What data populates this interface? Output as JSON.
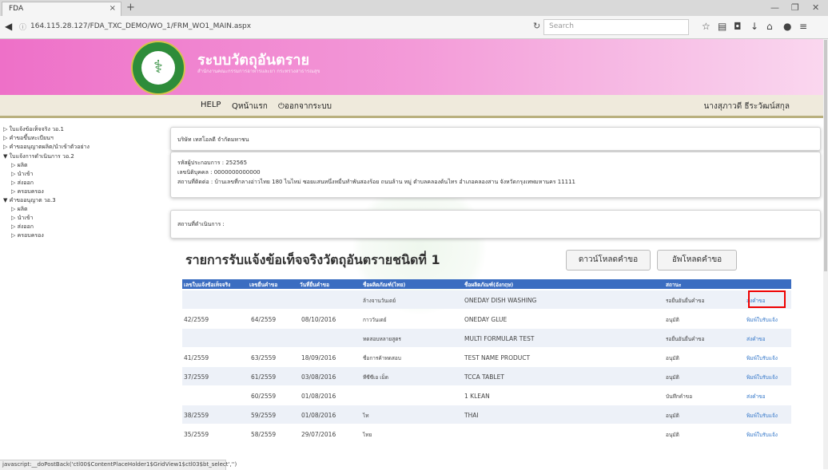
{
  "browser": {
    "tab_title": "FDA",
    "tab_close": "×",
    "new_tab": "+",
    "url": "164.115.28.127/FDA_TXC_DEMO/WO_1/FRM_WO1_MAIN.aspx",
    "search_placeholder": "Search",
    "status_text": "javascript:__doPostBack('ctl00$ContentPlaceHolder1$GridView1$ctl03$bt_select','')"
  },
  "header": {
    "site_title": "ระบบวัตถุอันตราย",
    "site_subtitle": "สำนักงานคณะกรรมการอาหารและยา กระทรวงสาธารณสุข"
  },
  "nav": {
    "help": "HELP",
    "home": "หน้าแรก",
    "logout": "ออกจากระบบ",
    "user_name": "นางสุภาวดี ธีระวัฒน์สกุล"
  },
  "sidebar": [
    {
      "label": "▷ ใบแจ้งข้อเท็จจริง วอ.1",
      "level": 0
    },
    {
      "label": "▷ คำขอขึ้นทะเบียนฯ",
      "level": 0
    },
    {
      "label": "▷ คำขออนุญาตผลิต/นำเข้าตัวอย่าง",
      "level": 0
    },
    {
      "label": "▼ ใบแจ้งการดำเนินการ วอ.2",
      "level": 0
    },
    {
      "label": "▷ ผลิต",
      "level": 1
    },
    {
      "label": "▷ นำเข้า",
      "level": 1
    },
    {
      "label": "▷ ส่งออก",
      "level": 1
    },
    {
      "label": "▷ ครอบครอง",
      "level": 1
    },
    {
      "label": "▼ คำขออนุญาต วอ.3",
      "level": 0
    },
    {
      "label": "▷ ผลิต",
      "level": 1
    },
    {
      "label": "▷ นำเข้า",
      "level": 1
    },
    {
      "label": "▷ ส่งออก",
      "level": 1
    },
    {
      "label": "▷ ครอบครอง",
      "level": 1
    }
  ],
  "company": {
    "name": "บริษัท เทสโอลดี จำกัดมหาชน",
    "operator_code": "รหัสผู้ประกอบการ : 252565",
    "tax_id": "เลขนิติบุคคล : 0000000000000",
    "address": "สถานที่ติดต่อ : บ้านเลขที่กลางอ่าวไทย 180 ไนไหม่ ซอยแสนหนึ่งหมื่นทำพันสองร้อย ถนนล้าน หมู่ ตำบลคลองต้นไทร อำเภอคลองสาน จังหวัดกรุงเทพมหานคร 11111",
    "site_label": "สถานที่ดำเนินการ :"
  },
  "list": {
    "title": "รายการรับแจ้งข้อเท็จจริงวัตถุอันตรายชนิดที่ 1",
    "download_button": "ดาวน์โหลดคำขอ",
    "upload_button": "อัพโหลดคำขอ"
  },
  "table": {
    "headers": [
      "เลขใบแจ้งข้อเท็จจริง",
      "เลขยื่นคำขอ",
      "วันที่ยื่นคำขอ",
      "ชื่อผลิตภัณฑ์(ไทย)",
      "ชื่อผลิตภัณฑ์(อังกฤษ)",
      "สถานะ",
      ""
    ],
    "rows": [
      {
        "fact_no": "",
        "req_no": "",
        "date": "",
        "name_th": "ล้างจานวันเดย์",
        "name_en": "ONEDAY DISH WASHING",
        "status": "รอยื่นยันยื่นคำขอ",
        "action": "ส่งคำขอ"
      },
      {
        "fact_no": "42/2559",
        "req_no": "64/2559",
        "date": "08/10/2016",
        "name_th": "กาววันเดย์",
        "name_en": "ONEDAY GLUE",
        "status": "อนุมัติ",
        "action": "พิมพ์ใบรับแจ้ง"
      },
      {
        "fact_no": "",
        "req_no": "",
        "date": "",
        "name_th": "ทดสอบหลายสูตร",
        "name_en": "MULTI FORMULAR TEST",
        "status": "รอยื่นยันยื่นคำขอ",
        "action": "ส่งคำขอ"
      },
      {
        "fact_no": "41/2559",
        "req_no": "63/2559",
        "date": "18/09/2016",
        "name_th": "ชื่อการค้าทดสอบ",
        "name_en": "TEST NAME PRODUCT",
        "status": "อนุมัติ",
        "action": "พิมพ์ใบรับแจ้ง"
      },
      {
        "fact_no": "37/2559",
        "req_no": "61/2559",
        "date": "03/08/2016",
        "name_th": "ทีซีซีเอ เม็ด",
        "name_en": "TCCA TABLET",
        "status": "อนุมัติ",
        "action": "พิมพ์ใบรับแจ้ง"
      },
      {
        "fact_no": "",
        "req_no": "60/2559",
        "date": "01/08/2016",
        "name_th": "",
        "name_en": "1 KLEAN",
        "status": "บันทึกคำขอ",
        "action": "ส่งคำขอ"
      },
      {
        "fact_no": "38/2559",
        "req_no": "59/2559",
        "date": "01/08/2016",
        "name_th": "ไท",
        "name_en": "THAI",
        "status": "อนุมัติ",
        "action": "พิมพ์ใบรับแจ้ง"
      },
      {
        "fact_no": "35/2559",
        "req_no": "58/2559",
        "date": "29/07/2016",
        "name_th": "ไทย",
        "name_en": "",
        "status": "อนุมัติ",
        "action": "พิมพ์ใบรับแจ้ง"
      }
    ]
  },
  "colors": {
    "header_pink": "#ee70c8",
    "table_header": "#3b6dc1",
    "link_blue": "#3477c9",
    "highlight_red": "#e00000"
  }
}
